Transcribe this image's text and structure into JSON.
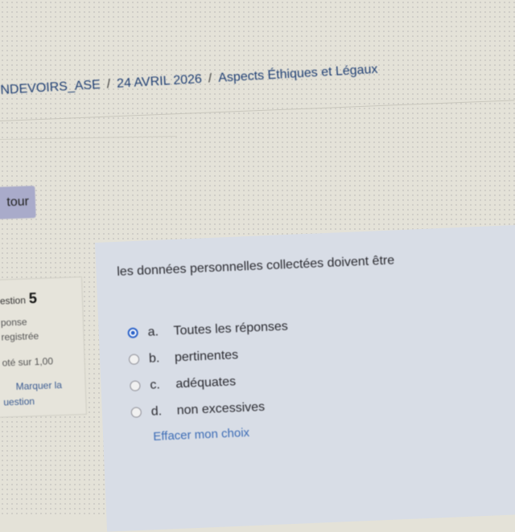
{
  "breadcrumb": {
    "items": [
      "NDEVOIRS_ASE",
      "24 AVRIL 2026",
      "Aspects Éthiques et Légaux"
    ],
    "separator": "/"
  },
  "nav": {
    "back_label": "tour"
  },
  "question_info": {
    "label": "estion",
    "number": "5",
    "status_line1": "ponse",
    "status_line2": "registrée",
    "grade": "oté sur 1,00",
    "flag_line1": "Marquer la",
    "flag_line2": "uestion"
  },
  "question": {
    "text": "les données personnelles collectées doivent être",
    "options": [
      {
        "letter": "a.",
        "text": "Toutes les réponses",
        "selected": true
      },
      {
        "letter": "b.",
        "text": "pertinentes",
        "selected": false
      },
      {
        "letter": "c.",
        "text": "adéquates",
        "selected": false
      },
      {
        "letter": "d.",
        "text": "non excessives",
        "selected": false
      }
    ],
    "clear_label": "Effacer mon choix"
  },
  "colors": {
    "link": "#1f3f74",
    "accent": "#2b62c9",
    "panel": "#d8dde6",
    "button": "#a9abca"
  }
}
